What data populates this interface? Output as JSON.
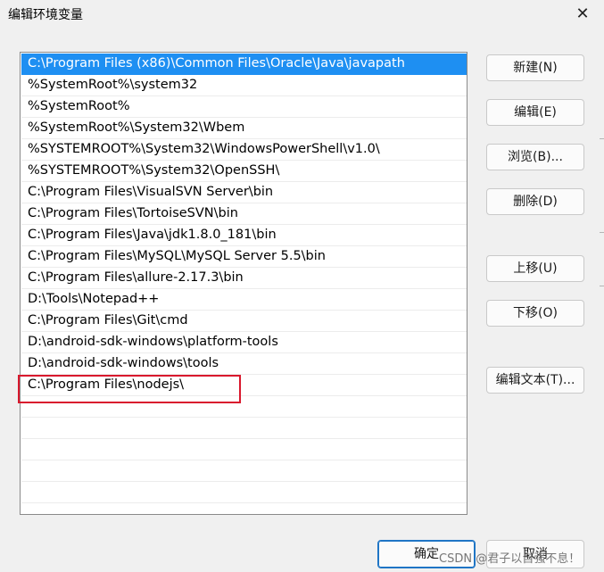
{
  "window": {
    "title": "编辑环境变量",
    "close_glyph": "✕"
  },
  "list": {
    "items": [
      "C:\\Program Files (x86)\\Common Files\\Oracle\\Java\\javapath",
      "%SystemRoot%\\system32",
      "%SystemRoot%",
      "%SystemRoot%\\System32\\Wbem",
      "%SYSTEMROOT%\\System32\\WindowsPowerShell\\v1.0\\",
      "%SYSTEMROOT%\\System32\\OpenSSH\\",
      "C:\\Program Files\\VisualSVN Server\\bin",
      "C:\\Program Files\\TortoiseSVN\\bin",
      "C:\\Program Files\\Java\\jdk1.8.0_181\\bin",
      "C:\\Program Files\\MySQL\\MySQL Server 5.5\\bin",
      "C:\\Program Files\\allure-2.17.3\\bin",
      "D:\\Tools\\Notepad++",
      "C:\\Program Files\\Git\\cmd",
      "D:\\android-sdk-windows\\platform-tools",
      "D:\\android-sdk-windows\\tools",
      "C:\\Program Files\\nodejs\\",
      "",
      "",
      "",
      "",
      "",
      ""
    ],
    "selected_index": 0,
    "highlighted_index": 15
  },
  "buttons": {
    "new": "新建(N)",
    "edit": "编辑(E)",
    "browse": "浏览(B)...",
    "delete": "删除(D)",
    "move_up": "上移(U)",
    "move_down": "下移(O)",
    "edit_text": "编辑文本(T)...",
    "ok": "确定",
    "cancel": "取消"
  },
  "watermark": "CSDN @君子以自强不息！",
  "colors": {
    "selection": "#1e8ff2",
    "highlight_border": "#d9182d"
  }
}
